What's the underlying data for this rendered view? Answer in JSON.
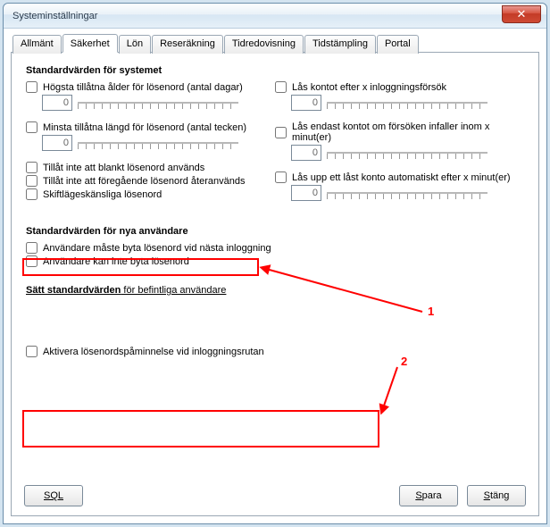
{
  "window": {
    "title": "Systeminställningar"
  },
  "tabs": [
    "Allmänt",
    "Säkerhet",
    "Lön",
    "Reseräkning",
    "Tidredovisning",
    "Tidstämpling",
    "Portal"
  ],
  "activeTab": 1,
  "section1": {
    "title": "Standardvärden för systemet"
  },
  "left": {
    "opt1": "Högsta tillåtna ålder för lösenord (antal dagar)",
    "val1": "0",
    "opt2": "Minsta tillåtna längd för lösenord (antal tecken)",
    "val2": "0",
    "opt3": "Tillåt inte att blankt lösenord används",
    "opt4": "Tillåt inte att föregående lösenord återanvänds",
    "opt5": "Skiftlägeskänsliga lösenord"
  },
  "right": {
    "opt1": "Lås kontot efter x inloggningsförsök",
    "val1": "0",
    "opt2": "Lås endast kontot om försöken infaller inom x minut(er)",
    "val2": "0",
    "opt3": "Lås upp ett låst konto automatiskt efter x minut(er)",
    "val3": "0"
  },
  "section2": {
    "title": "Standardvärden för nya användare"
  },
  "new1": "Användare måste byta lösenord vid nästa inloggning",
  "new2": "Användare kan inte byta lösenord",
  "linkrow": {
    "bold": "Sätt standardvärden",
    "rest": " för befintliga användare"
  },
  "activate": "Aktivera lösenordspåminnelse vid inloggningsrutan",
  "buttons": {
    "sql": "SQL",
    "save": "Spara",
    "close": "Stäng"
  },
  "anno": {
    "l1": "1",
    "l2": "2"
  }
}
